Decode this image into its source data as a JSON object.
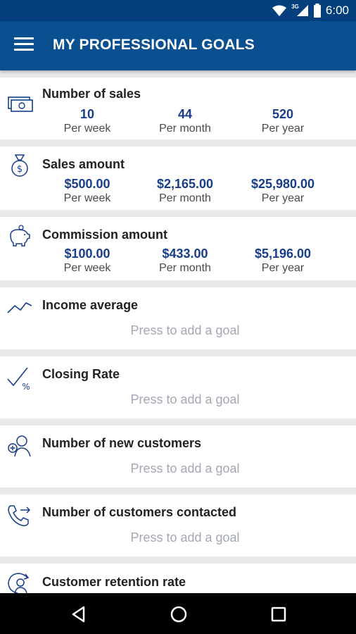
{
  "status": {
    "network": "3G",
    "time": "6:00"
  },
  "appbar": {
    "title": "MY PROFESSIONAL GOALS",
    "menu_icon": "hamburger-menu-icon"
  },
  "colors": {
    "appbar": "#0a4f90",
    "status_bar": "#023f7c",
    "value_blue": "#173d8b",
    "placeholder_gray": "#a3a8b4"
  },
  "goals": [
    {
      "title": "Number of sales",
      "icon": "banknote-icon",
      "values": [
        {
          "value": "10",
          "label": "Per week"
        },
        {
          "value": "44",
          "label": "Per month"
        },
        {
          "value": "520",
          "label": "Per year"
        }
      ]
    },
    {
      "title": "Sales amount",
      "icon": "money-bag-icon",
      "values": [
        {
          "value": "$500.00",
          "label": "Per week"
        },
        {
          "value": "$2,165.00",
          "label": "Per month"
        },
        {
          "value": "$25,980.00",
          "label": "Per year"
        }
      ]
    },
    {
      "title": "Commission amount",
      "icon": "piggy-bank-icon",
      "values": [
        {
          "value": "$100.00",
          "label": "Per week"
        },
        {
          "value": "$433.00",
          "label": "Per month"
        },
        {
          "value": "$5,196.00",
          "label": "Per year"
        }
      ]
    },
    {
      "title": "Income average",
      "icon": "trend-line-icon",
      "placeholder": "Press to add a goal"
    },
    {
      "title": "Closing Rate",
      "icon": "check-percent-icon",
      "placeholder": "Press to add a goal"
    },
    {
      "title": "Number of new customers",
      "icon": "add-user-icon",
      "placeholder": "Press to add a goal"
    },
    {
      "title": "Number of customers contacted",
      "icon": "phone-outgoing-icon",
      "placeholder": "Press to add a goal"
    },
    {
      "title": "Customer retention rate",
      "icon": "user-refresh-icon"
    }
  ],
  "nav": {
    "back": "back-icon",
    "home": "home-icon",
    "recents": "recents-icon"
  }
}
